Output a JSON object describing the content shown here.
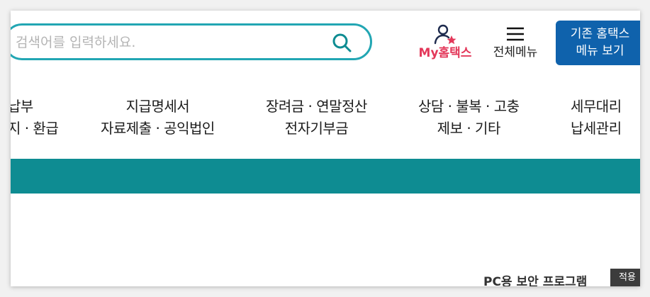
{
  "search": {
    "placeholder": "검색어를 입력하세요.",
    "value": ""
  },
  "header": {
    "my_hometax": "My홈택스",
    "all_menu": "전체메뉴",
    "old_menu_line1": "기존 홈택스",
    "old_menu_line2": "메뉴 보기"
  },
  "nav": [
    {
      "line1": "납부",
      "line2": "지 · 환급"
    },
    {
      "line1": "지급명세서",
      "line2": "자료제출 · 공익법인"
    },
    {
      "line1": "장려금 · 연말정산",
      "line2": "전자기부금"
    },
    {
      "line1": "상담 · 불복 · 고충",
      "line2": "제보 · 기타"
    },
    {
      "line1": "세무대리",
      "line2": "납세관리"
    }
  ],
  "colors": {
    "accent_teal": "#0e8c92",
    "brand_blue": "#0f62ac",
    "my_red": "#e3385a",
    "search_border": "#22a6b3"
  },
  "footer": {
    "pc_security": "PC용 보안 프로그램",
    "apply_label": "적용"
  }
}
